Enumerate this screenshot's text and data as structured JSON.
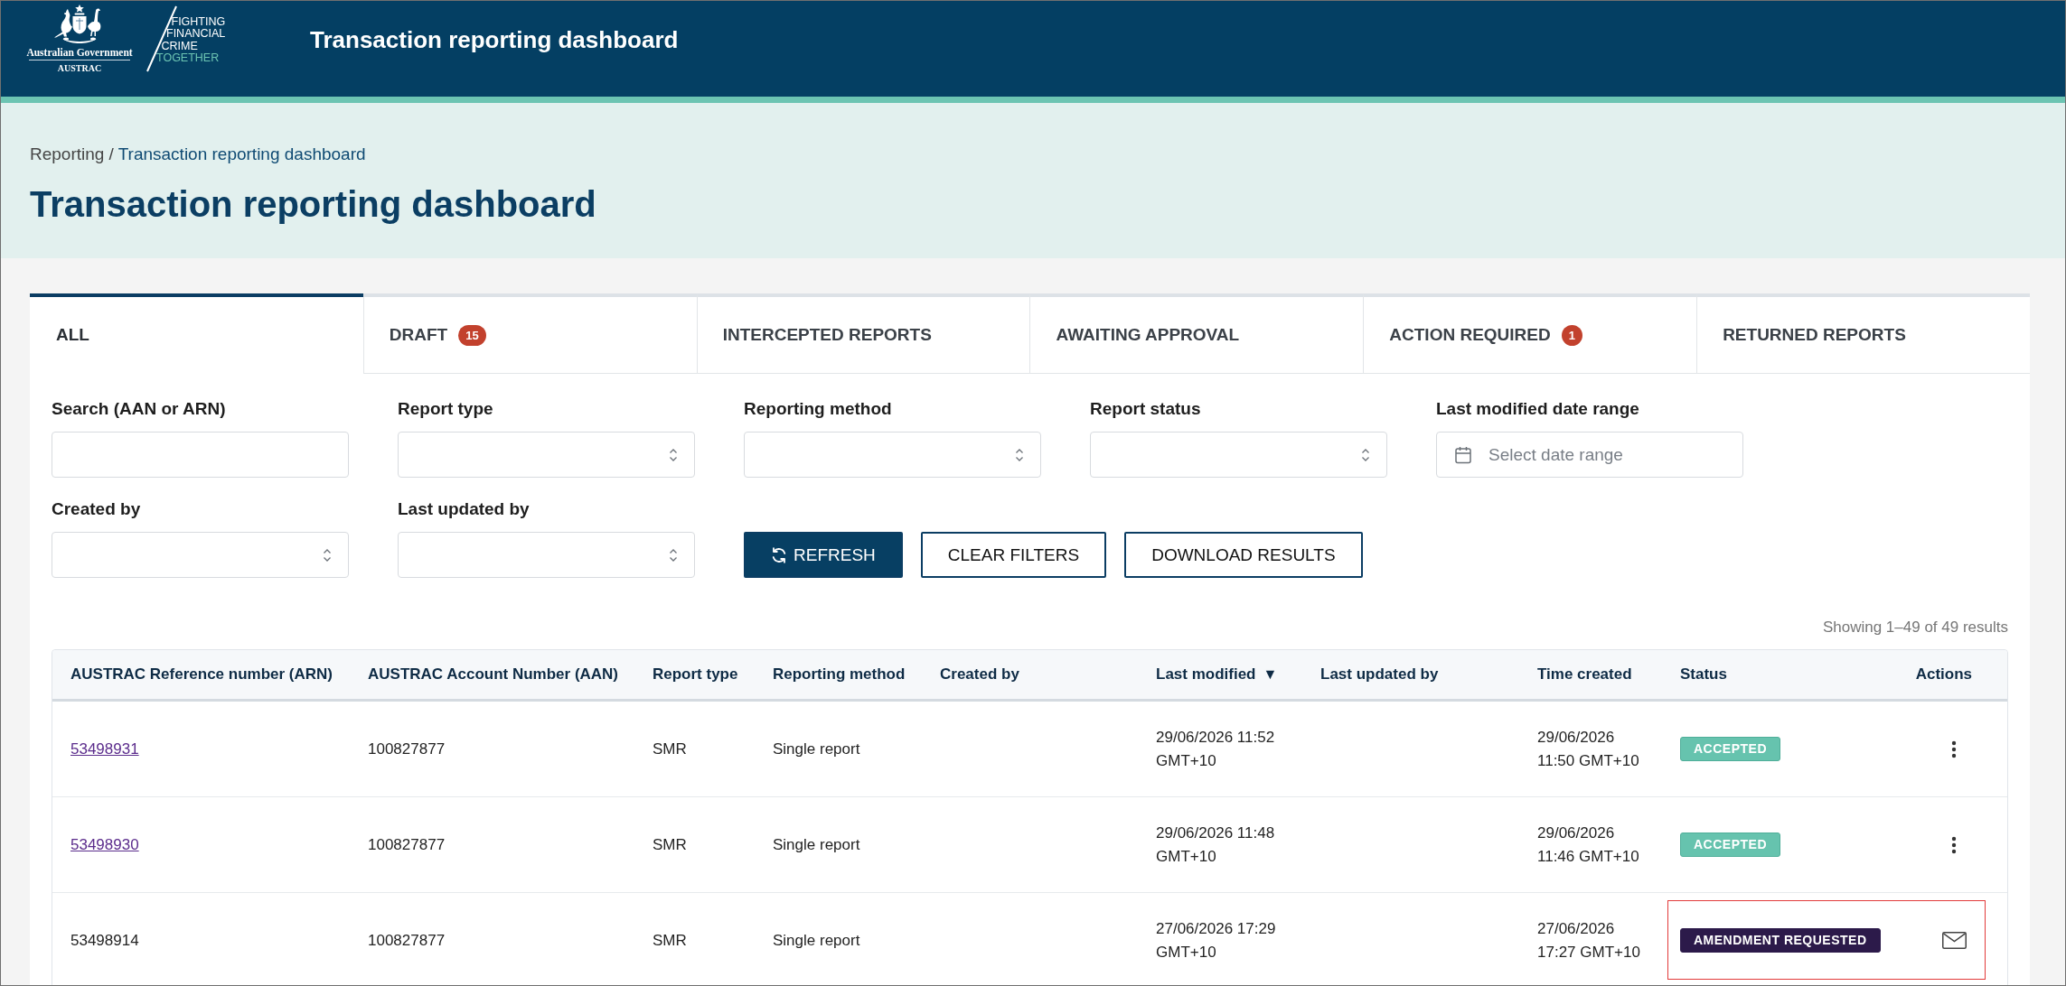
{
  "header": {
    "logo": {
      "government": "Australian Government",
      "agency": "AUSTRAC",
      "tagline": [
        {
          "text": "FIGHTING",
          "accent": false
        },
        {
          "text": "FINANCIAL",
          "accent": false
        },
        {
          "text": "CRIME",
          "accent": false
        },
        {
          "text": "TOGETHER",
          "accent": true
        }
      ]
    },
    "title": "Transaction reporting dashboard"
  },
  "breadcrumb": {
    "separator": "/",
    "items": [
      {
        "label": "Reporting",
        "current": false
      },
      {
        "label": "Transaction reporting dashboard",
        "current": true
      }
    ]
  },
  "page_title": "Transaction reporting dashboard",
  "tabs": [
    {
      "label": "ALL",
      "selected": true
    },
    {
      "label": "DRAFT",
      "count": "15",
      "selected": false
    },
    {
      "label": "INTERCEPTED REPORTS",
      "selected": false
    },
    {
      "label": "AWAITING APPROVAL",
      "selected": false
    },
    {
      "label": "ACTION REQUIRED",
      "count": "1",
      "selected": false
    },
    {
      "label": "RETURNED REPORTS",
      "selected": false
    }
  ],
  "filters": [
    {
      "label": "Search (AAN or ARN)",
      "kind": "text"
    },
    {
      "label": "Report type",
      "kind": "select"
    },
    {
      "label": "Reporting method",
      "kind": "select"
    },
    {
      "label": "Report status",
      "kind": "select"
    },
    {
      "label": "Last modified date range",
      "kind": "date",
      "placeholder": "Select date range"
    },
    {
      "label": "Created by",
      "kind": "select"
    },
    {
      "label": "Last updated by",
      "kind": "select"
    }
  ],
  "buttons": [
    {
      "label": "REFRESH",
      "kind": "refresh"
    },
    {
      "label": "CLEAR FILTERS",
      "kind": "outline"
    },
    {
      "label": "DOWNLOAD RESULTS",
      "kind": "outline"
    }
  ],
  "results_summary": "Showing 1–49 of 49 results",
  "table": {
    "columns": [
      {
        "label": "AUSTRAC Reference number (ARN)"
      },
      {
        "label": "AUSTRAC Account Number (AAN)"
      },
      {
        "label": "Report type"
      },
      {
        "label": "Reporting method"
      },
      {
        "label": "Created by"
      },
      {
        "label": "Last modified",
        "sort_arrow": "▼"
      },
      {
        "label": "Last updated by"
      },
      {
        "label": "Time created"
      },
      {
        "label": "Status"
      },
      {
        "label": "Actions"
      }
    ],
    "rows": [
      {
        "arn": "53498931",
        "arn_link": true,
        "aan": "100827877",
        "report_type": "SMR",
        "reporting_method": "Single report",
        "last_modified": "29/06/2026 11:52 GMT+10",
        "time_created": "29/06/2026 11:50 GMT+10",
        "status": {
          "label": "ACCEPTED",
          "kind": "accepted"
        },
        "action": {
          "kind": "menu"
        },
        "highlighted": false
      },
      {
        "arn": "53498930",
        "arn_link": true,
        "aan": "100827877",
        "report_type": "SMR",
        "reporting_method": "Single report",
        "last_modified": "29/06/2026 11:48 GMT+10",
        "time_created": "29/06/2026 11:46 GMT+10",
        "status": {
          "label": "ACCEPTED",
          "kind": "accepted"
        },
        "action": {
          "kind": "menu"
        },
        "highlighted": false
      },
      {
        "arn": "53498914",
        "arn_link": false,
        "aan": "100827877",
        "report_type": "SMR",
        "reporting_method": "Single report",
        "last_modified": "27/06/2026 17:29 GMT+10",
        "time_created": "27/06/2026 17:27 GMT+10",
        "status": {
          "label": "AMENDMENT REQUESTED",
          "kind": "amendment"
        },
        "action": {
          "kind": "message"
        },
        "highlighted": true
      }
    ]
  }
}
